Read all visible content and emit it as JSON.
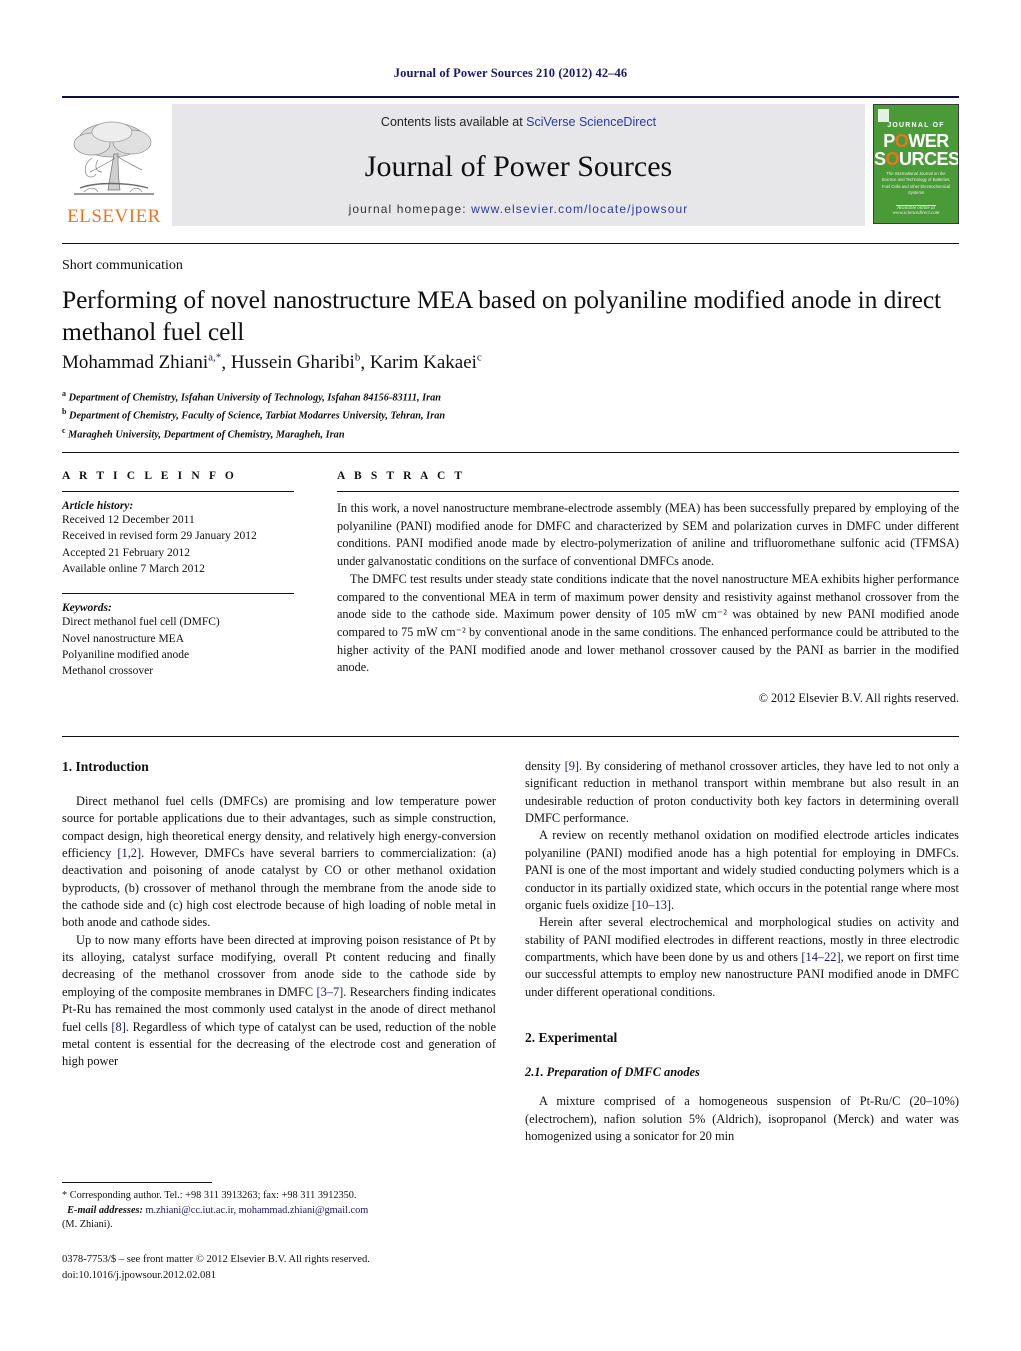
{
  "running_head": "Journal of Power Sources 210 (2012) 42–46",
  "masthead": {
    "publisher_name": "ELSEVIER",
    "contents_prefix": "Contents lists available at ",
    "contents_link": "SciVerse ScienceDirect",
    "journal_title": "Journal of Power Sources",
    "homepage_prefix": "journal homepage: ",
    "homepage_url": "www.elsevier.com/locate/jpowsour",
    "cover": {
      "line_top": "JOURNAL OF",
      "word1_a": "P",
      "word1_o": "O",
      "word1_b": "WER",
      "word2_a": "S",
      "word2_o": "O",
      "word2_b": "URCES",
      "subtitle": "The International Journal on the Science and Technology of Batteries, Fuel Cells and other Electrochemical Systems",
      "footer": "Available online at www.sciencedirect.com"
    }
  },
  "article": {
    "doctype": "Short communication",
    "title": "Performing of novel nanostructure MEA based on polyaniline modified anode in direct methanol fuel cell",
    "authors": [
      {
        "name": "Mohammad Zhiani",
        "sup": "a,*"
      },
      {
        "name": "Hussein Gharibi",
        "sup": "b"
      },
      {
        "name": "Karim Kakaei",
        "sup": "c"
      }
    ],
    "affiliations": [
      {
        "mark": "a",
        "text": "Department of Chemistry, Isfahan University of Technology, Isfahan 84156-83111, Iran"
      },
      {
        "mark": "b",
        "text": "Department of Chemistry, Faculty of Science, Tarbiat Modarres University, Tehran, Iran"
      },
      {
        "mark": "c",
        "text": "Maragheh University, Department of Chemistry, Maragheh, Iran"
      }
    ]
  },
  "article_info": {
    "heading": "A R T I C L E    I N F O",
    "history_label": "Article history:",
    "history": [
      "Received 12 December 2011",
      "Received in revised form 29 January 2012",
      "Accepted 21 February 2012",
      "Available online 7 March 2012"
    ],
    "keywords_label": "Keywords:",
    "keywords": [
      "Direct methanol fuel cell (DMFC)",
      "Novel nanostructure MEA",
      "Polyaniline modified anode",
      "Methanol crossover"
    ]
  },
  "abstract": {
    "heading": "A B S T R A C T",
    "paragraph1": "In this work, a novel nanostructure membrane-electrode assembly (MEA) has been successfully prepared by employing of the polyaniline (PANI) modified anode for DMFC and characterized by SEM and polarization curves in DMFC under different conditions. PANI modified anode made by electro-polymerization of aniline and trifluoromethane sulfonic acid (TFMSA) under galvanostatic conditions on the surface of conventional DMFCs anode.",
    "paragraph2": "The DMFC test results under steady state conditions indicate that the novel nanostructure MEA exhibits higher performance compared to the conventional MEA in term of maximum power density and resistivity against methanol crossover from the anode side to the cathode side. Maximum power density of 105 mW cm⁻² was obtained by new PANI modified anode compared to 75 mW cm⁻² by conventional anode in the same conditions. The enhanced performance could be attributed to the higher activity of the PANI modified anode and lower methanol crossover caused by the PANI as barrier in the modified anode.",
    "copyright": "© 2012 Elsevier B.V. All rights reserved."
  },
  "body": {
    "section1_heading": "1.  Introduction",
    "left_p1_a": "Direct methanol fuel cells (DMFCs) are promising and low temperature power source for portable applications due to their advantages, such as simple construction, compact design, high theoretical energy density, and relatively high energy-conversion efficiency ",
    "left_p1_ref1": "[1,2]",
    "left_p1_b": ". However, DMFCs have several barriers to commercialization: (a) deactivation and poisoning of anode catalyst by CO or other methanol oxidation byproducts, (b) crossover of methanol through the membrane from the anode side to the cathode side and (c) high cost electrode because of high loading of noble metal in both anode and cathode sides.",
    "left_p2_a": "Up to now many efforts have been directed at improving poison resistance of Pt by its alloying, catalyst surface modifying, overall Pt content reducing and finally decreasing of the methanol crossover from anode side to the cathode side by employing of the composite membranes in DMFC ",
    "left_p2_ref1": "[3–7]",
    "left_p2_b": ". Researchers finding indicates Pt-Ru has remained the most commonly used catalyst in the anode of direct methanol fuel cells ",
    "left_p2_ref2": "[8]",
    "left_p2_c": ". Regardless of which type of catalyst can be used, reduction of the noble metal content is essential for the decreasing of the electrode cost and generation of high power",
    "right_p1_a": "density ",
    "right_p1_ref1": "[9]",
    "right_p1_b": ". By considering of methanol crossover articles, they have led to not only a significant reduction in methanol transport within membrane but also result in an undesirable reduction of proton conductivity both key factors in determining overall DMFC performance.",
    "right_p2_a": "A review on recently methanol oxidation on modified electrode articles indicates polyaniline (PANI) modified anode has a high potential for employing in DMFCs. PANI is one of the most important and widely studied conducting polymers which is a conductor in its partially oxidized state, which occurs in the potential range where most organic fuels oxidize ",
    "right_p2_ref1": "[10–13]",
    "right_p2_b": ".",
    "right_p3_a": "Herein after several electrochemical and morphological studies on activity and stability of PANI modified electrodes in different reactions, mostly in three electrodic compartments, which have been done by us and others ",
    "right_p3_ref1": "[14–22]",
    "right_p3_b": ", we report on first time our successful attempts to employ new nanostructure PANI modified anode in DMFC under different operational conditions.",
    "section2_heading": "2.  Experimental",
    "section21_heading": "2.1.  Preparation of DMFC anodes",
    "right_p4": "A mixture comprised of a homogeneous suspension of Pt-Ru/C (20–10%) (electrochem), nafion solution 5% (Aldrich), isopropanol (Merck) and water was homogenized using a sonicator for 20 min"
  },
  "footnote": {
    "corresponding": "* Corresponding author. Tel.: +98 311 3913263; fax: +98 311 3912350.",
    "email_label": "E-mail addresses:",
    "email1": "m.zhiani@cc.iut.ac.ir",
    "email2": "mohammad.zhiani@gmail.com",
    "email_owner": "(M. Zhiani).",
    "issn_line": "0378-7753/$ – see front matter © 2012 Elsevier B.V. All rights reserved.",
    "doi_line": "doi:10.1016/j.jpowsour.2012.02.081"
  },
  "colors": {
    "link_blue": "#2b3b9e",
    "ref_blue": "#1a1a66",
    "elsevier_orange": "#e87722",
    "cover_green": "#4a9a38",
    "banner_gray": "#e7e7e9"
  }
}
